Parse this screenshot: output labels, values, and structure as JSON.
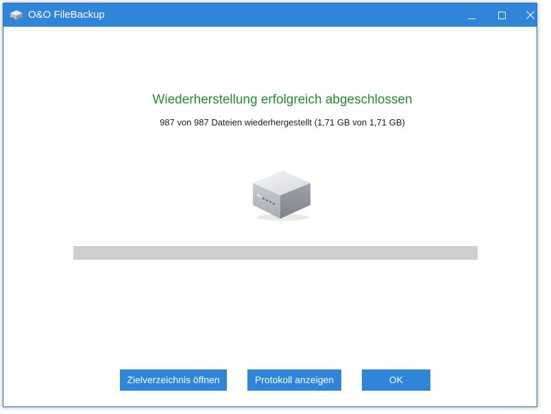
{
  "window": {
    "title": "O&O FileBackup"
  },
  "status": {
    "headline": "Wiederherstellung erfolgreich abgeschlossen",
    "detail": "987 von 987 Dateien wiederhergestellt (1,71 GB von 1,71 GB)"
  },
  "icons": {
    "app": "drive-icon",
    "main": "drive-icon",
    "minimize": "minimize-icon",
    "maximize": "maximize-icon",
    "close": "close-icon"
  },
  "colors": {
    "titlebar": "#2f86d8",
    "headline": "#1e8f2c",
    "button": "#2f86d8",
    "progress_track": "#cfcfcf"
  },
  "buttons": {
    "open_target": "Zielverzeichnis öffnen",
    "show_log": "Protokoll anzeigen",
    "ok": "OK"
  }
}
